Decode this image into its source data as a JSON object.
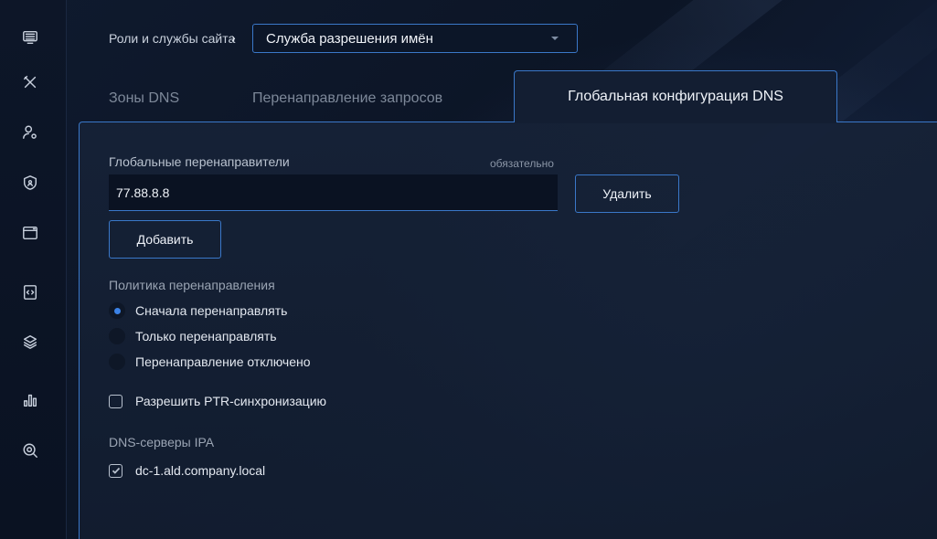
{
  "breadcrumb": {
    "parent": "Роли и службы сайта",
    "separator": "›",
    "service": {
      "value": "Служба разрешения имён",
      "open": false
    }
  },
  "tabs": [
    {
      "label": "Зоны DNS",
      "active": false
    },
    {
      "label": "Перенаправление запросов",
      "active": false
    },
    {
      "label": "Глобальная конфигурация DNS",
      "active": true
    }
  ],
  "forwarders": {
    "label": "Глобальные перенаправители",
    "required_hint": "обязательно",
    "value": "77.88.8.8",
    "delete_label": "Удалить",
    "add_label": "Добавить"
  },
  "policy": {
    "label": "Политика перенаправления",
    "options": [
      {
        "label": "Сначала перенаправлять",
        "selected": true
      },
      {
        "label": "Только перенаправлять",
        "selected": false
      },
      {
        "label": "Перенаправление отключено",
        "selected": false
      }
    ]
  },
  "ptr_sync": {
    "label": "Разрешить PTR-синхронизацию",
    "checked": false
  },
  "ipa_dns": {
    "label": "DNS-серверы IPA",
    "servers": [
      {
        "name": "dc-1.ald.company.local",
        "checked": true
      }
    ]
  },
  "sidebar": {
    "icons": [
      "monitor-icon",
      "tools-icon",
      "user-settings-icon",
      "shield-icon",
      "window-icon",
      "code-file-icon",
      "layers-icon",
      "bar-chart-icon",
      "search-zoom-icon"
    ]
  },
  "colors": {
    "accent": "#3a78c9",
    "radio_selected": "#3b82e6",
    "background": "#0f1a2e"
  }
}
